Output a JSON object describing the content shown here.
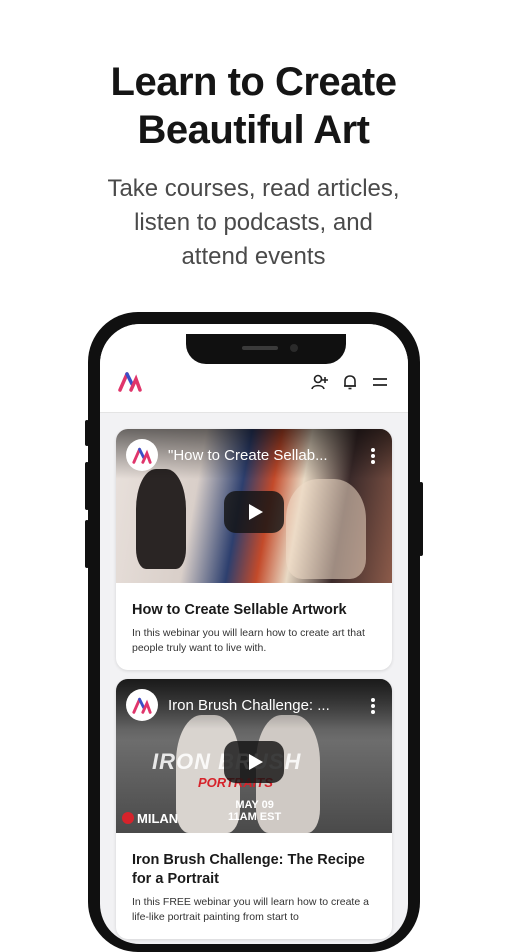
{
  "hero": {
    "title_line1": "Learn to Create",
    "title_line2": "Beautiful Art",
    "subtitle_line1": "Take courses, read articles,",
    "subtitle_line2": "listen to podcasts, and",
    "subtitle_line3": "attend events"
  },
  "appbar": {
    "icons": [
      "app-logo-icon",
      "add-user-icon",
      "bell-icon",
      "menu-icon"
    ]
  },
  "cards": [
    {
      "video_title": "\"How to Create Sellab...",
      "title": "How to Create Sellable Artwork",
      "description": "In this webinar you will learn how to create art that people truly want to live with."
    },
    {
      "video_title": "Iron Brush Challenge: ...",
      "title": "Iron Brush Challenge: The Recipe for a Portrait",
      "description": "In this FREE webinar you will learn how to create a life-like portrait painting from start to",
      "overlay_line1": "IRON BRUSH",
      "overlay_line2": "PORTRAITS",
      "date": "MAY 09",
      "time": "11AM EST",
      "brand": "MILAN"
    }
  ],
  "colors": {
    "accent_pink": "#e0356b",
    "accent_blue": "#3a4fc7",
    "accent_red": "#d6232b"
  }
}
